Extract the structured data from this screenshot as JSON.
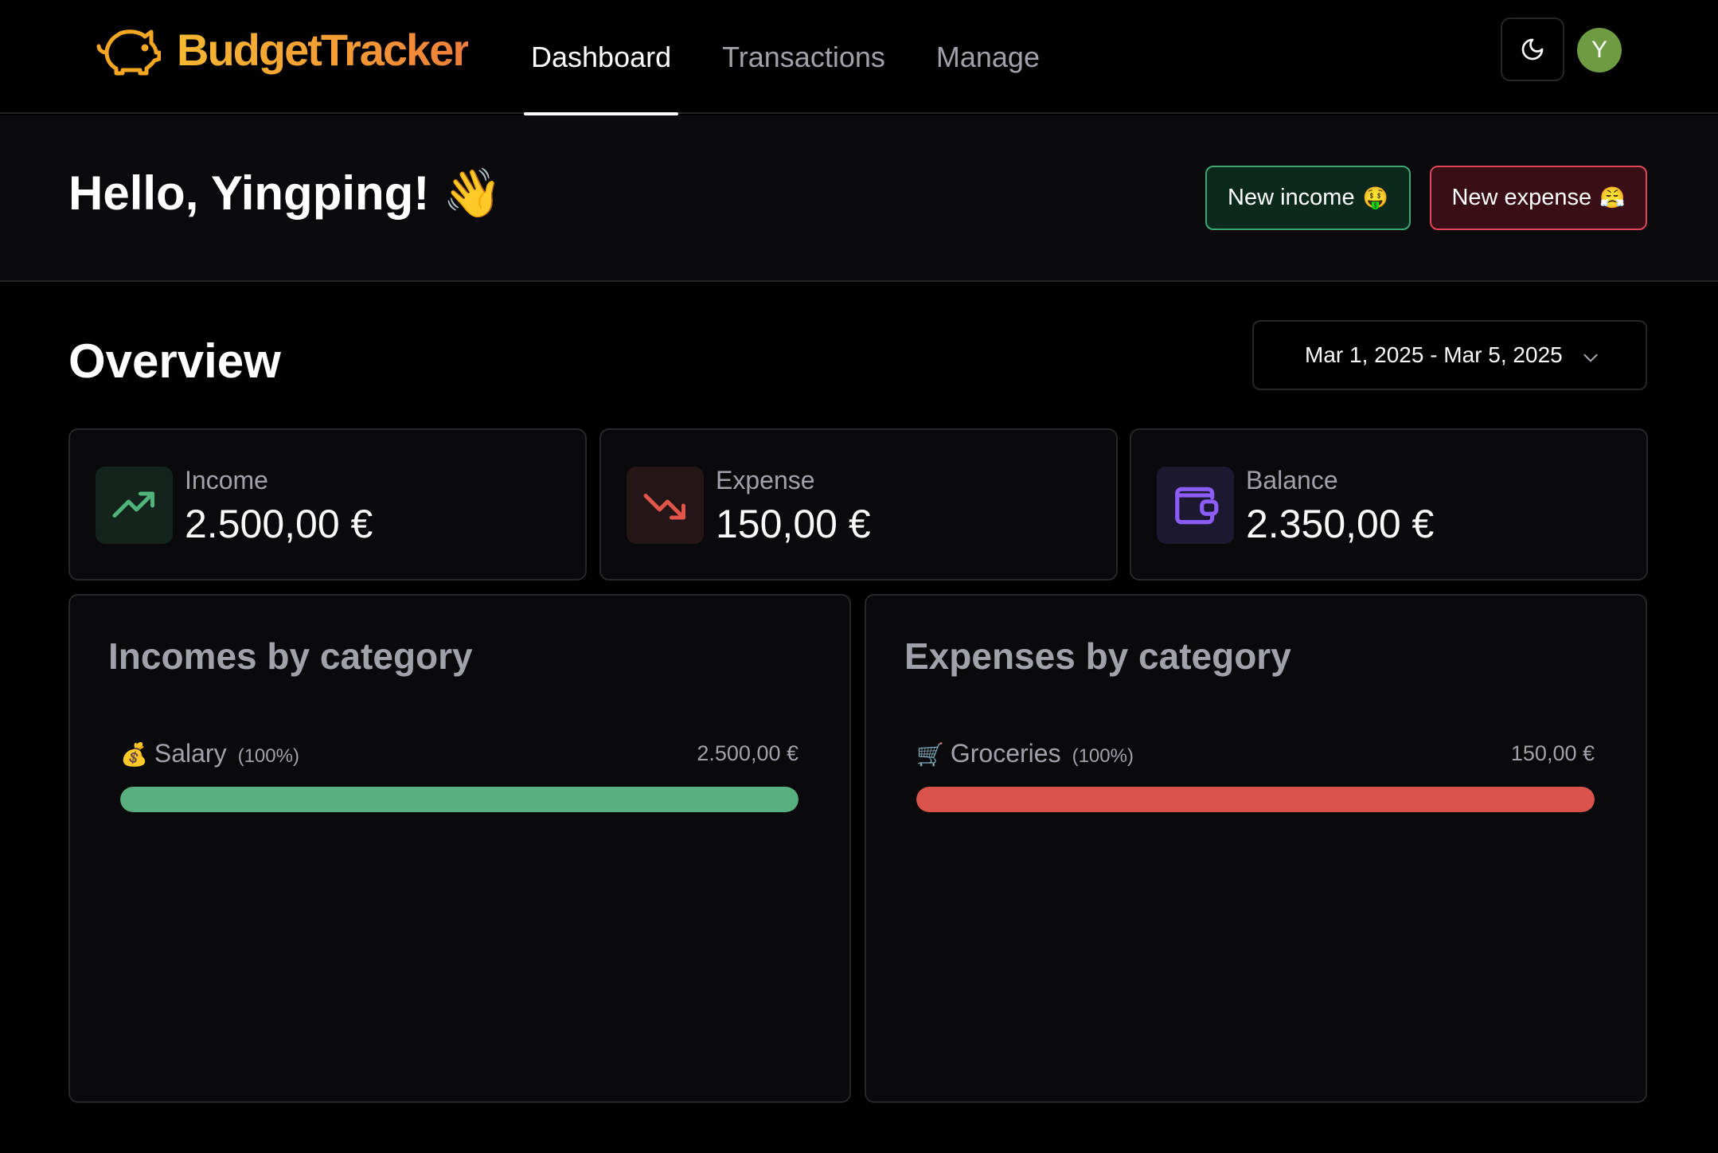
{
  "app": {
    "name": "BudgetTracker",
    "logo_icon": "piggy-bank-icon",
    "brand_colors": [
      "#f5b731",
      "#ee7d3b"
    ]
  },
  "nav": {
    "items": [
      {
        "label": "Dashboard",
        "active": true
      },
      {
        "label": "Transactions",
        "active": false
      },
      {
        "label": "Manage",
        "active": false
      }
    ],
    "theme_toggle_icon": "moon-icon",
    "avatar_initial": "Y",
    "avatar_color": "#6f9b43"
  },
  "greeting": {
    "text": "Hello, Yingping!",
    "emoji": "👋"
  },
  "actions": {
    "new_income_label": "New income",
    "new_income_emoji": "🤑",
    "new_expense_label": "New expense",
    "new_expense_emoji": "😤"
  },
  "overview": {
    "title": "Overview",
    "date_range": "Mar 1, 2025 - Mar 5, 2025",
    "stats": [
      {
        "label": "Income",
        "value": "2.500,00 €",
        "icon": "trending-up-icon",
        "color": "#4fb57c"
      },
      {
        "label": "Expense",
        "value": "150,00 €",
        "icon": "trending-down-icon",
        "color": "#e0544a"
      },
      {
        "label": "Balance",
        "value": "2.350,00 €",
        "icon": "wallet-icon",
        "color": "#8b5cf6"
      }
    ]
  },
  "incomes_by_category": {
    "title": "Incomes by category",
    "items": [
      {
        "emoji": "💰",
        "name": "Salary",
        "percent_label": "(100%)",
        "amount": "2.500,00 €",
        "percent": 100,
        "color": "#58b07e"
      }
    ]
  },
  "expenses_by_category": {
    "title": "Expenses by category",
    "items": [
      {
        "emoji": "🛒",
        "name": "Groceries",
        "percent_label": "(100%)",
        "amount": "150,00 €",
        "percent": 100,
        "color": "#d9534a"
      }
    ]
  }
}
